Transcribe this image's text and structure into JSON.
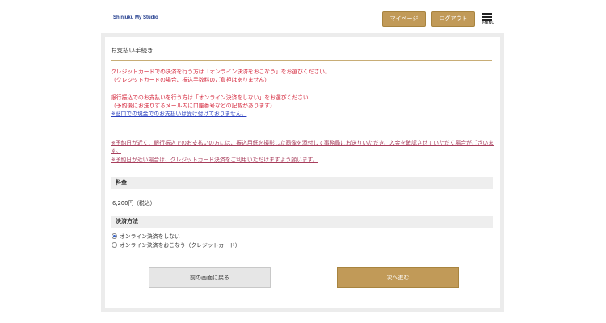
{
  "header": {
    "logo_text": "Shinjuku My Studio",
    "mypage_label": "マイページ",
    "logout_label": "ログアウト",
    "menu_label": "MENU"
  },
  "payment": {
    "title": "お支払い手続き",
    "card_line1": "クレジットカードでの決済を行う方は「オンライン決済をおこなう」をお選びください。",
    "card_line2": "（クレジットカードの場合、振込手数料のご負担はありません）",
    "bank_line1": "銀行振込でのお支払いを行う方は「オンライン決済をしない」をお選びください",
    "bank_line2": "（予約後にお送りするメール内に口座番号などの記載があります）",
    "bank_line3": "※窓口での現金でのお支払いは受け付けておりません。",
    "note_line1": "※予約日が近く、銀行振込でのお支払いの方には、振込用紙を撮影した画像を添付して事務局にお送りいただき、入金を確認させていただく場合がございます。",
    "note_line2": "※予約日が近い場合は、クレジットカード決済をご利用いただけますよう願います。"
  },
  "fee": {
    "heading": "料金",
    "value": "6,200円（税込）"
  },
  "method": {
    "heading": "決済方法",
    "options": [
      {
        "label": "オンライン決済をしない",
        "selected": true
      },
      {
        "label": "オンライン決済をおこなう（クレジットカード）",
        "selected": false
      }
    ]
  },
  "actions": {
    "back_label": "前の画面に戻る",
    "next_label": "次へ進む"
  },
  "colors": {
    "accent": "#c19a58",
    "warning_red": "#d4253a",
    "link_blue": "#2a3fbf"
  }
}
